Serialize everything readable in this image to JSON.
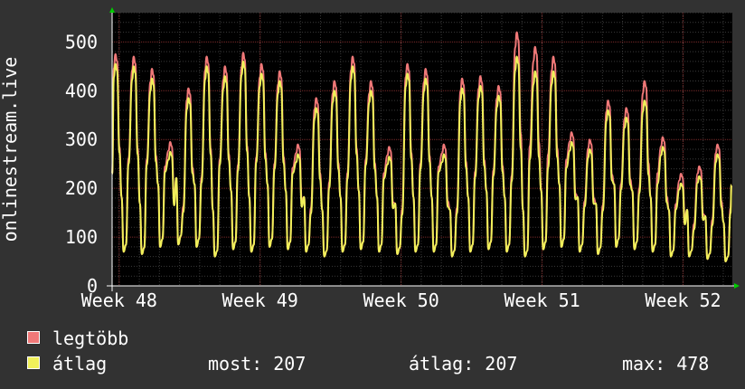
{
  "chart_data": {
    "type": "line",
    "ylabel": "onlinestream.live",
    "ylim": [
      0,
      560
    ],
    "yticks": [
      0,
      100,
      200,
      300,
      400,
      500
    ],
    "xlim": [
      47.95,
      52.35
    ],
    "xticks": [
      {
        "value": 48,
        "label": "Week 48"
      },
      {
        "value": 49,
        "label": "Week 49"
      },
      {
        "value": 50,
        "label": "Week 50"
      },
      {
        "value": 51,
        "label": "Week 51"
      },
      {
        "value": 52,
        "label": "Week 52"
      }
    ],
    "grid": true,
    "legend_placement": "bottom-left",
    "series": [
      {
        "name": "legtöbb",
        "color": "#f07878"
      },
      {
        "name": "átlag",
        "color": "#f0f05a"
      }
    ],
    "daily_cycles": {
      "x_start": 47.95,
      "x_end": 52.35,
      "peaks_max": [
        475,
        470,
        445,
        295,
        405,
        470,
        450,
        478,
        455,
        440,
        290,
        385,
        420,
        470,
        420,
        285,
        455,
        445,
        290,
        425,
        430,
        410,
        520,
        490,
        470,
        315,
        300,
        380,
        365,
        420,
        305,
        230,
        245,
        290
      ],
      "peaks_avg": [
        455,
        450,
        425,
        275,
        385,
        450,
        430,
        460,
        435,
        420,
        270,
        365,
        400,
        450,
        400,
        265,
        435,
        425,
        270,
        405,
        410,
        390,
        470,
        440,
        440,
        295,
        280,
        360,
        345,
        380,
        285,
        210,
        225,
        270
      ],
      "troughs": [
        70,
        65,
        80,
        85,
        80,
        60,
        75,
        70,
        80,
        75,
        70,
        60,
        70,
        75,
        70,
        65,
        70,
        70,
        60,
        70,
        75,
        70,
        60,
        75,
        80,
        70,
        65,
        80,
        75,
        70,
        60,
        60,
        55,
        50
      ],
      "last_max": 207,
      "last_avg": 207
    }
  },
  "legend": {
    "max_label": "legtöbb",
    "avg_label": "átlag",
    "max_color": "#f07878",
    "avg_color": "#f0f05a"
  },
  "stats": {
    "now": "most: 207",
    "avg": "átlag: 207",
    "max": "max: 478"
  }
}
